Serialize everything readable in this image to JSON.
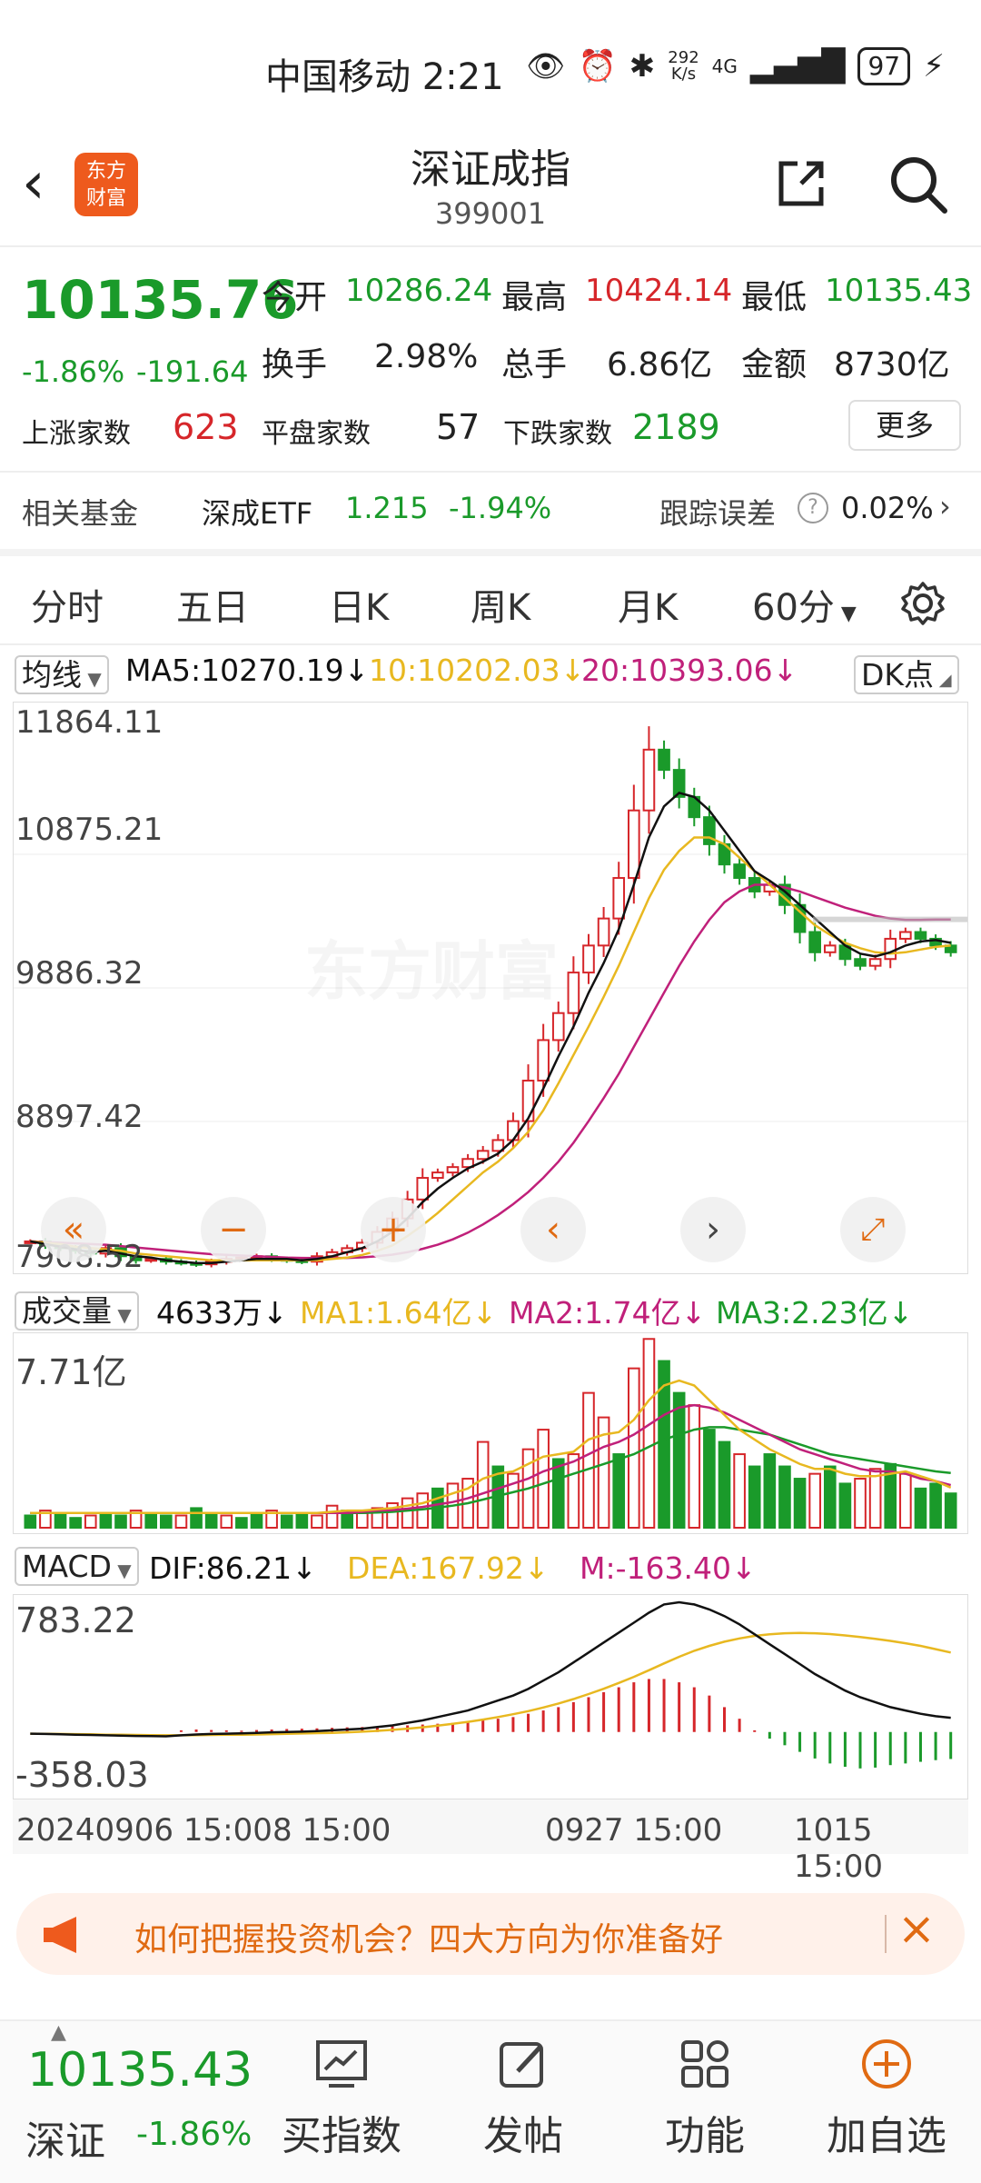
{
  "status_bar": {
    "carrier_time": "中国移动 2:21",
    "net_speed_top": "292",
    "net_speed_unit": "K/s",
    "network": "4G",
    "battery": "97",
    "icons": [
      "eye-icon",
      "alarm-icon",
      "bluetooth-icon",
      "signal-icon",
      "charging-icon"
    ]
  },
  "header": {
    "back_label": "‹",
    "logo_text": "东方财富",
    "title": "深证成指",
    "code": "399001"
  },
  "quote": {
    "price": "10135.76",
    "change_pct": "-1.86%",
    "change_abs": "-191.64",
    "open_label": "今开",
    "open_value": "10286.24",
    "high_label": "最高",
    "high_value": "10424.14",
    "low_label": "最低",
    "low_value": "10135.43",
    "turnover_label": "换手",
    "turnover_value": "2.98%",
    "volume_label": "总手",
    "volume_value": "6.86亿",
    "amount_label": "金额",
    "amount_value": "8730亿",
    "up_label": "上涨家数",
    "up_value": "623",
    "flat_label": "平盘家数",
    "flat_value": "57",
    "down_label": "下跌家数",
    "down_value": "2189",
    "more_label": "更多"
  },
  "fund": {
    "label": "相关基金",
    "name": "深成ETF",
    "price": "1.215",
    "change": "-1.94%",
    "tracking_label": "跟踪误差",
    "tracking_value": "0.02%"
  },
  "tabs": [
    "分时",
    "五日",
    "日K",
    "周K",
    "月K",
    "60分"
  ],
  "active_tab": "60分",
  "ma_row": {
    "select": "均线",
    "ma5": "MA5:10270.19",
    "ma10": "10:10202.03",
    "ma20": "20:10393.06",
    "dk": "DK点"
  },
  "price_axis": [
    "11864.11",
    "10875.21",
    "9886.32",
    "8897.42",
    "7908.52"
  ],
  "volume_row": {
    "select": "成交量",
    "value": "4633万",
    "ma1": "MA1:1.64亿",
    "ma2": "MA2:1.74亿",
    "ma3": "MA3:2.23亿",
    "axis_top": "7.71亿"
  },
  "macd_row": {
    "select": "MACD",
    "dif": "DIF:86.21",
    "dea": "DEA:167.92",
    "m": "M:-163.40",
    "axis_top": "783.22",
    "axis_bottom": "-358.03"
  },
  "time_axis": [
    "20240906 15:00",
    "8 15:00",
    "0927 15:00",
    "1015 15:00"
  ],
  "banner": {
    "text": "如何把握投资机会？四大方向为你准备好"
  },
  "bottom": {
    "price": "10135.43",
    "name": "深证",
    "change": "-1.86%",
    "items": [
      "买指数",
      "发帖",
      "功能",
      "加自选"
    ]
  },
  "colors": {
    "up": "#d6262a",
    "down": "#1a9a2a",
    "accent": "#e06a12",
    "ma5": "#111111",
    "ma10": "#e8b820",
    "ma20": "#c0207a"
  },
  "chart_data": [
    {
      "type": "line",
      "name_hint": "price",
      "x": [
        "20240906 15:00",
        "8 15:00",
        "0927 15:00",
        "1015 15:00"
      ],
      "ylim": [
        7908.52,
        11864.11
      ],
      "close": [
        8010,
        7980,
        7960,
        7940,
        7920,
        7960,
        7900,
        7870,
        7880,
        7860,
        7850,
        7840,
        7860,
        7880,
        7890,
        7900,
        7880,
        7870,
        7860,
        7900,
        7930,
        7960,
        8000,
        8080,
        8180,
        8320,
        8480,
        8520,
        8560,
        8620,
        8680,
        8760,
        8900,
        9200,
        9500,
        9700,
        10000,
        10200,
        10400,
        10700,
        11200,
        11650,
        11500,
        11300,
        11150,
        10950,
        10800,
        10700,
        10600,
        10650,
        10500,
        10300,
        10150,
        10200,
        10100,
        10050,
        10100,
        10250,
        10300,
        10250,
        10200,
        10150
      ],
      "ma5": [
        8010,
        7990,
        7970,
        7950,
        7930,
        7940,
        7920,
        7900,
        7890,
        7870,
        7860,
        7850,
        7850,
        7860,
        7870,
        7880,
        7880,
        7880,
        7870,
        7880,
        7900,
        7930,
        7960,
        8010,
        8080,
        8180,
        8300,
        8400,
        8480,
        8550,
        8600,
        8660,
        8760,
        8920,
        9140,
        9380,
        9600,
        9850,
        10070,
        10320,
        10650,
        11000,
        11230,
        11330,
        11300,
        11200,
        11050,
        10900,
        10750,
        10680,
        10600,
        10500,
        10400,
        10300,
        10200,
        10140,
        10120,
        10150,
        10200,
        10230,
        10240,
        10220
      ],
      "ma10": [
        8010,
        8000,
        7990,
        7970,
        7960,
        7950,
        7940,
        7920,
        7910,
        7900,
        7890,
        7880,
        7870,
        7870,
        7870,
        7870,
        7870,
        7870,
        7870,
        7870,
        7880,
        7890,
        7910,
        7940,
        7980,
        8050,
        8130,
        8220,
        8320,
        8420,
        8520,
        8600,
        8700,
        8820,
        8980,
        9180,
        9390,
        9600,
        9820,
        10050,
        10300,
        10550,
        10760,
        10900,
        11000,
        11000,
        10950,
        10850,
        10750,
        10650,
        10550,
        10450,
        10350,
        10280,
        10220,
        10180,
        10150,
        10140,
        10150,
        10170,
        10190,
        10200
      ],
      "ma20": [
        8010,
        8005,
        8000,
        7995,
        7990,
        7985,
        7975,
        7965,
        7955,
        7945,
        7935,
        7925,
        7915,
        7910,
        7905,
        7900,
        7895,
        7890,
        7888,
        7886,
        7886,
        7888,
        7892,
        7900,
        7912,
        7930,
        7955,
        7985,
        8025,
        8075,
        8135,
        8205,
        8285,
        8375,
        8480,
        8600,
        8740,
        8900,
        9070,
        9250,
        9450,
        9650,
        9850,
        10050,
        10230,
        10390,
        10520,
        10600,
        10650,
        10650,
        10630,
        10600,
        10560,
        10520,
        10480,
        10450,
        10420,
        10400,
        10390,
        10390,
        10392,
        10393
      ]
    },
    {
      "type": "bar",
      "name_hint": "volume",
      "ylim": [
        0,
        7.71
      ],
      "values": [
        0.5,
        0.7,
        0.6,
        0.4,
        0.5,
        0.6,
        0.5,
        0.7,
        0.6,
        0.5,
        0.5,
        0.8,
        0.6,
        0.5,
        0.4,
        0.6,
        0.7,
        0.5,
        0.6,
        0.5,
        0.9,
        0.7,
        0.6,
        0.8,
        1.0,
        1.2,
        1.4,
        1.6,
        1.8,
        2.0,
        3.5,
        2.5,
        2.2,
        3.2,
        4.0,
        2.8,
        3.0,
        5.5,
        4.5,
        3.0,
        6.5,
        7.7,
        6.8,
        5.5,
        5.0,
        4.0,
        3.5,
        3.0,
        2.5,
        3.0,
        2.5,
        2.0,
        2.2,
        2.5,
        1.8,
        2.0,
        2.4,
        2.6,
        2.2,
        1.6,
        1.8,
        1.4
      ],
      "up": [
        0,
        1,
        0,
        0,
        1,
        0,
        0,
        1,
        0,
        0,
        1,
        0,
        0,
        1,
        0,
        0,
        1,
        0,
        0,
        1,
        1,
        0,
        1,
        1,
        1,
        1,
        1,
        0,
        1,
        1,
        1,
        0,
        1,
        1,
        1,
        0,
        1,
        1,
        1,
        0,
        1,
        1,
        0,
        0,
        1,
        0,
        0,
        1,
        0,
        0,
        0,
        0,
        1,
        0,
        0,
        1,
        1,
        0,
        1,
        0,
        0,
        0
      ],
      "ma1": [
        0.6,
        0.6,
        0.6,
        0.6,
        0.6,
        0.6,
        0.6,
        0.6,
        0.6,
        0.6,
        0.6,
        0.6,
        0.6,
        0.6,
        0.6,
        0.6,
        0.6,
        0.6,
        0.6,
        0.6,
        0.65,
        0.7,
        0.7,
        0.75,
        0.8,
        0.9,
        1.0,
        1.2,
        1.4,
        1.6,
        2.0,
        2.2,
        2.3,
        2.6,
        2.9,
        3.0,
        3.1,
        3.6,
        3.8,
        3.9,
        4.4,
        5.2,
        5.8,
        6.0,
        5.8,
        5.2,
        4.6,
        4.0,
        3.6,
        3.2,
        2.9,
        2.6,
        2.4,
        2.4,
        2.2,
        2.1,
        2.1,
        2.2,
        2.3,
        2.1,
        1.9,
        1.64
      ],
      "ma2": [
        0.6,
        0.6,
        0.6,
        0.6,
        0.6,
        0.6,
        0.6,
        0.6,
        0.6,
        0.6,
        0.6,
        0.6,
        0.6,
        0.6,
        0.6,
        0.6,
        0.6,
        0.6,
        0.6,
        0.6,
        0.6,
        0.6,
        0.65,
        0.7,
        0.72,
        0.78,
        0.85,
        0.95,
        1.05,
        1.2,
        1.4,
        1.6,
        1.8,
        2.0,
        2.3,
        2.5,
        2.7,
        3.0,
        3.3,
        3.5,
        3.8,
        4.2,
        4.6,
        4.9,
        5.0,
        4.9,
        4.7,
        4.4,
        4.1,
        3.8,
        3.5,
        3.2,
        3.0,
        2.8,
        2.6,
        2.4,
        2.3,
        2.3,
        2.2,
        2.0,
        1.9,
        1.74
      ],
      "ma3": [
        0.6,
        0.6,
        0.6,
        0.6,
        0.6,
        0.6,
        0.6,
        0.6,
        0.6,
        0.6,
        0.6,
        0.6,
        0.6,
        0.6,
        0.6,
        0.6,
        0.6,
        0.6,
        0.6,
        0.6,
        0.6,
        0.6,
        0.6,
        0.62,
        0.65,
        0.7,
        0.75,
        0.82,
        0.9,
        1.0,
        1.15,
        1.3,
        1.45,
        1.6,
        1.8,
        2.0,
        2.2,
        2.4,
        2.6,
        2.8,
        3.0,
        3.3,
        3.6,
        3.8,
        4.0,
        4.1,
        4.1,
        4.0,
        3.9,
        3.8,
        3.6,
        3.4,
        3.2,
        3.0,
        2.9,
        2.8,
        2.7,
        2.6,
        2.5,
        2.4,
        2.3,
        2.23
      ]
    },
    {
      "type": "bar",
      "name_hint": "macd",
      "ylim": [
        -358.03,
        783.22
      ],
      "m": [
        0,
        0,
        0,
        0,
        0,
        0,
        0,
        0,
        0,
        0,
        10,
        15,
        12,
        10,
        8,
        12,
        15,
        18,
        20,
        22,
        25,
        28,
        30,
        32,
        35,
        40,
        45,
        50,
        55,
        60,
        70,
        80,
        90,
        110,
        130,
        150,
        180,
        210,
        240,
        270,
        300,
        320,
        320,
        300,
        270,
        220,
        150,
        80,
        10,
        -40,
        -80,
        -120,
        -160,
        -190,
        -210,
        -220,
        -215,
        -200,
        -190,
        -180,
        -170,
        -163
      ],
      "dif": [
        -10,
        -12,
        -14,
        -16,
        -18,
        -20,
        -22,
        -24,
        -25,
        -26,
        -20,
        -15,
        -12,
        -10,
        -8,
        -5,
        -2,
        0,
        2,
        5,
        10,
        15,
        20,
        30,
        40,
        55,
        70,
        90,
        110,
        130,
        160,
        190,
        220,
        260,
        310,
        360,
        420,
        480,
        540,
        600,
        660,
        720,
        770,
        783,
        770,
        740,
        700,
        650,
        590,
        530,
        470,
        410,
        350,
        300,
        250,
        210,
        180,
        150,
        130,
        110,
        95,
        86
      ],
      "dea": [
        -10,
        -11,
        -12,
        -13,
        -14,
        -16,
        -17,
        -18,
        -19,
        -20,
        -20,
        -19,
        -18,
        -17,
        -16,
        -15,
        -13,
        -11,
        -9,
        -7,
        -5,
        -2,
        2,
        7,
        13,
        20,
        28,
        38,
        49,
        61,
        75,
        90,
        107,
        126,
        148,
        172,
        199,
        229,
        261,
        296,
        333,
        373,
        414,
        454,
        490,
        520,
        545,
        565,
        580,
        590,
        596,
        598,
        596,
        591,
        583,
        573,
        562,
        550,
        536,
        520,
        500,
        480
      ]
    }
  ]
}
